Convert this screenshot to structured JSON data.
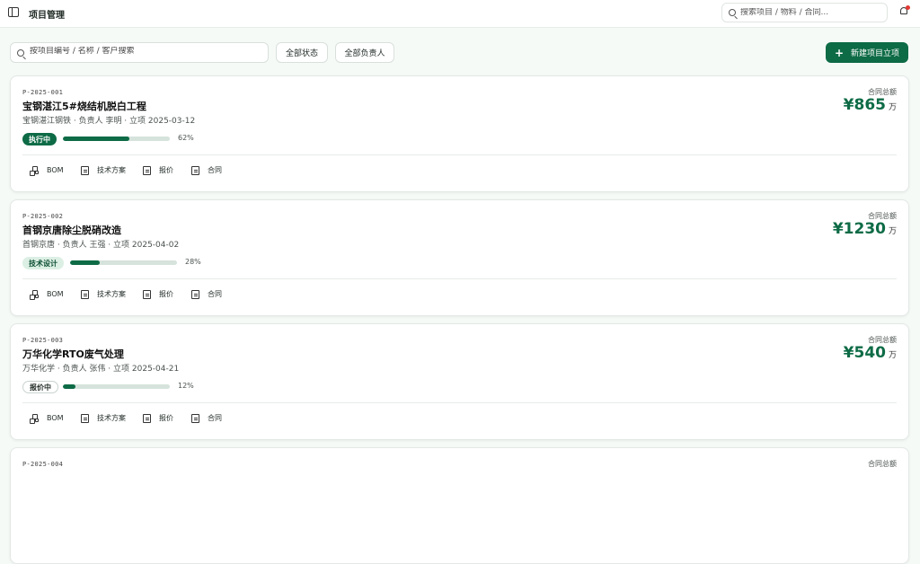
{
  "header": {
    "title": "项目管理",
    "search_placeholder": "搜索项目 / 物料 / 合同..."
  },
  "toolbar": {
    "search_placeholder": "按项目编号 / 名称 / 客户搜索",
    "status_filter": "全部状态",
    "owner_filter": "全部负责人",
    "new_button": "新建项目立项"
  },
  "colors": {
    "accent": "#0d6b46",
    "notification_dot": "#e53935"
  },
  "actions": [
    "BOM",
    "技术方案",
    "报价",
    "合同"
  ],
  "projects": [
    {
      "code": "P-2025-001",
      "name": "宝钢湛江5#烧结机脱白工程",
      "meta": "宝钢湛江钢铁 · 负责人 李明 · 立项 2025-03-12",
      "status": "执行中",
      "progress": 0.62,
      "progress_text": "62%",
      "amount_label": "合同总额",
      "amount": "¥865",
      "amount_unit": "万"
    },
    {
      "code": "P-2025-002",
      "name": "首钢京唐除尘脱硝改造",
      "meta": "首钢京唐 · 负责人 王强 · 立项 2025-04-02",
      "status": "技术设计",
      "progress": 0.28,
      "progress_text": "28%",
      "amount_label": "合同总额",
      "amount": "¥1230",
      "amount_unit": "万"
    },
    {
      "code": "P-2025-003",
      "name": "万华化学RTO废气处理",
      "meta": "万华化学 · 负责人 张伟 · 立项 2025-04-21",
      "status": "报价中",
      "progress": 0.12,
      "progress_text": "12%",
      "amount_label": "合同总额",
      "amount": "¥540",
      "amount_unit": "万"
    },
    {
      "code": "P-2025-004",
      "amount_label": "合同总额"
    }
  ]
}
